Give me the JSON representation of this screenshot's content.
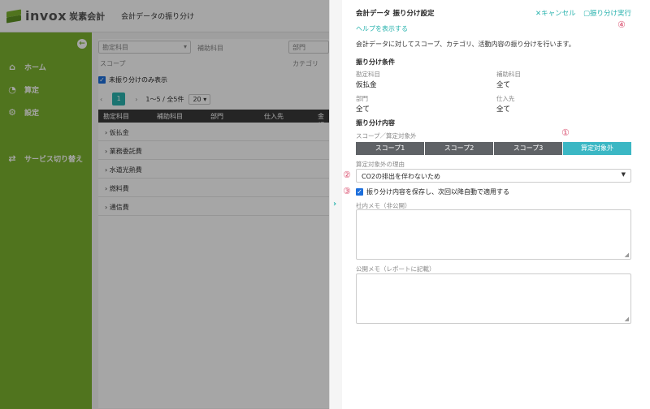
{
  "header": {
    "logo_text": "invox",
    "logo_sub": "炭素会計",
    "page_title": "会計データの振り分け"
  },
  "sidebar": {
    "items": [
      {
        "label": "ホーム",
        "icon": "home-icon"
      },
      {
        "label": "算定",
        "icon": "pie-chart-icon"
      },
      {
        "label": "設定",
        "icon": "gear-icon"
      },
      {
        "label": "サービス切り替え",
        "icon": "switch-icon"
      }
    ]
  },
  "main": {
    "filters": {
      "account_placeholder": "勘定科目",
      "sub_account_placeholder": "補助科目",
      "department_placeholder": "部門",
      "scope_label": "スコープ",
      "category_label": "カテゴリ"
    },
    "unassigned_only_label": "未振り分けのみ表示",
    "pager": {
      "page": "1",
      "range": "1〜5 / 全5件",
      "per_page": "20"
    },
    "table": {
      "headers": [
        "勘定科目",
        "補助科目",
        "部門",
        "仕入先",
        "金額"
      ],
      "rows": [
        "仮払金",
        "業務委託費",
        "水道光熱費",
        "燃料費",
        "通信費"
      ]
    }
  },
  "panel": {
    "title": "会計データ 振り分け設定",
    "cancel_label": "キャンセル",
    "execute_label": "振り分け実行",
    "help_link": "ヘルプを表示する",
    "description": "会計データに対してスコープ、カテゴリ、活動内容の振り分けを行います。",
    "conditions": {
      "heading": "振り分け条件",
      "account_label": "勘定科目",
      "account_value": "仮払金",
      "sub_account_label": "補助科目",
      "sub_account_value": "全て",
      "department_label": "部門",
      "department_value": "全て",
      "supplier_label": "仕入先",
      "supplier_value": "全て"
    },
    "content": {
      "heading": "振り分け内容",
      "scope_label": "スコープ／算定対象外",
      "tabs": [
        "スコープ1",
        "スコープ2",
        "スコープ3",
        "算定対象外"
      ],
      "active_tab": "算定対象外",
      "reason_label": "算定対象外の理由",
      "reason_value": "CO2の排出を伴わないため",
      "save_checkbox_label": "振り分け内容を保存し、次回以降自動で適用する",
      "internal_memo_label": "社内メモ（非公開）",
      "public_memo_label": "公開メモ（レポートに記載）"
    },
    "markers": [
      "①",
      "②",
      "③",
      "④"
    ],
    "accent_color": "#2ab3ae",
    "active_tab_color": "#3bb7c4",
    "marker_color": "#d94c6c"
  }
}
